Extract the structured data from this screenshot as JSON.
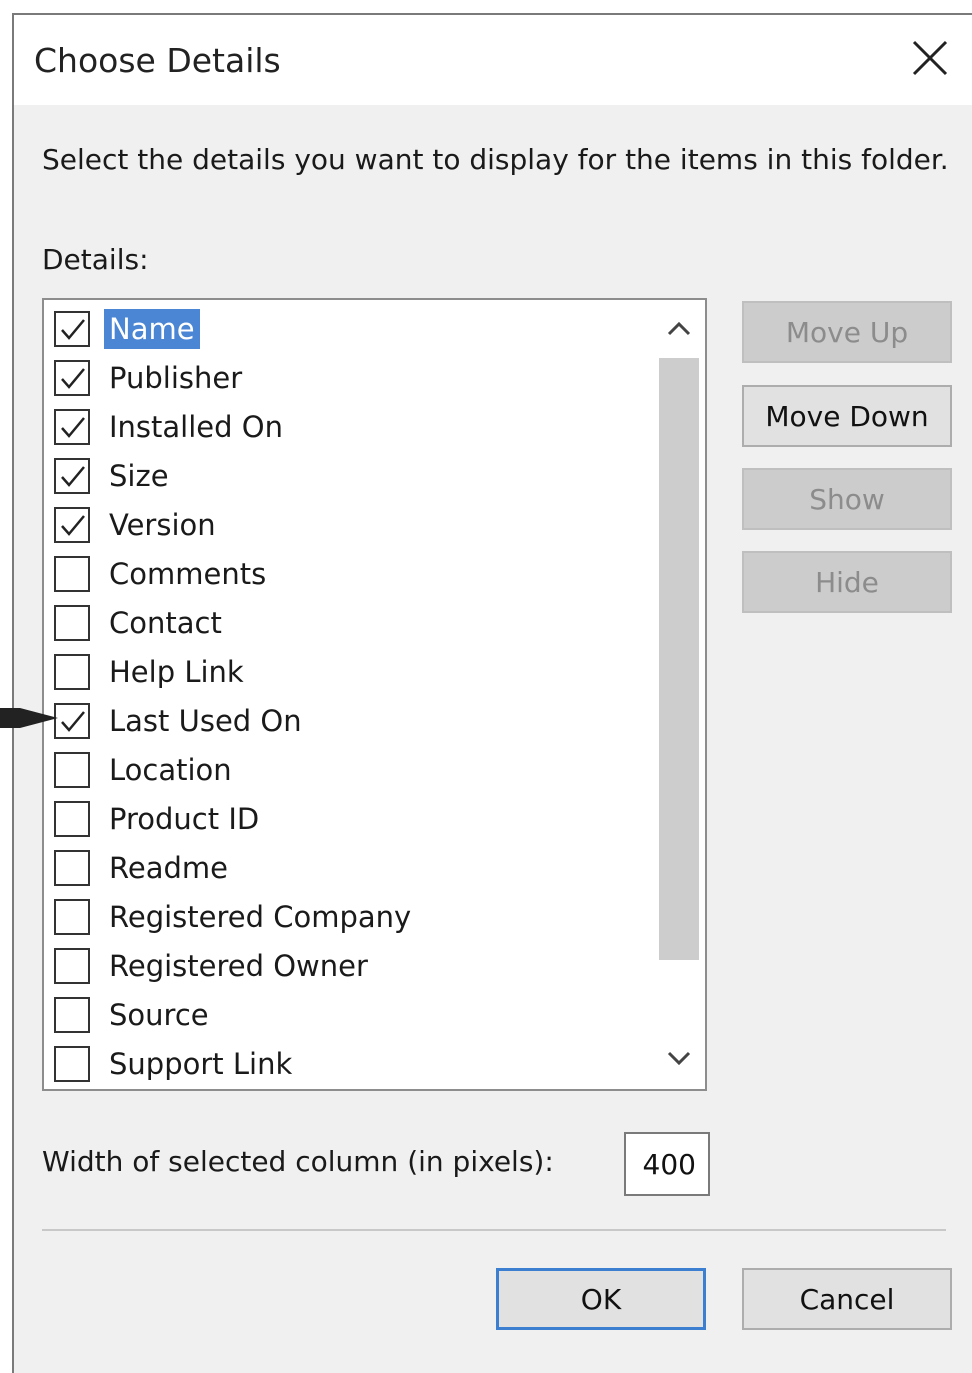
{
  "dialog": {
    "title": "Choose Details",
    "close_icon": "close-icon",
    "instructions": "Select the details you want to display for the items in this folder.",
    "details_label": "Details:"
  },
  "details": [
    {
      "label": "Name",
      "checked": true,
      "selected": true
    },
    {
      "label": "Publisher",
      "checked": true
    },
    {
      "label": "Installed On",
      "checked": true
    },
    {
      "label": "Size",
      "checked": true
    },
    {
      "label": "Version",
      "checked": true
    },
    {
      "label": "Comments",
      "checked": false
    },
    {
      "label": "Contact",
      "checked": false
    },
    {
      "label": "Help Link",
      "checked": false
    },
    {
      "label": "Last Used On",
      "checked": true
    },
    {
      "label": "Location",
      "checked": false
    },
    {
      "label": "Product ID",
      "checked": false
    },
    {
      "label": "Readme",
      "checked": false
    },
    {
      "label": "Registered Company",
      "checked": false
    },
    {
      "label": "Registered Owner",
      "checked": false
    },
    {
      "label": "Source",
      "checked": false
    },
    {
      "label": "Support Link",
      "checked": false
    }
  ],
  "buttons": {
    "move_up": "Move Up",
    "move_down": "Move Down",
    "show": "Show",
    "hide": "Hide",
    "ok": "OK",
    "cancel": "Cancel"
  },
  "width": {
    "label": "Width of selected column (in pixels):",
    "value": "400"
  },
  "colors": {
    "selection": "#4a86d4",
    "dialog_bg": "#f0f0f0",
    "disabled_btn": "#cccccc",
    "ok_border": "#3c7fd0"
  }
}
